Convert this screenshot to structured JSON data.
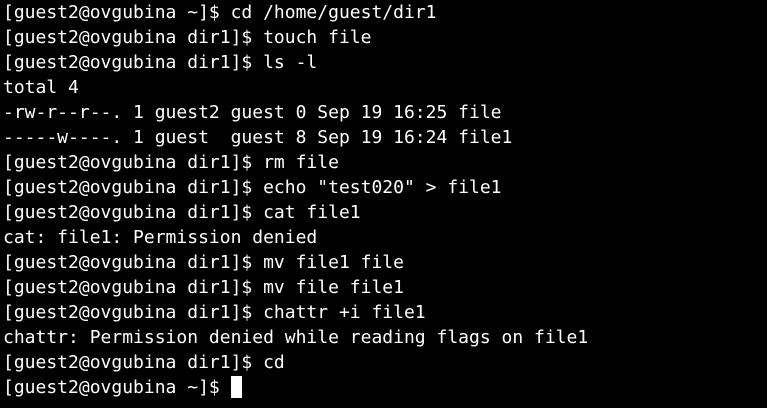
{
  "terminal": {
    "lines": [
      "[guest2@ovgubina ~]$ cd /home/guest/dir1",
      "[guest2@ovgubina dir1]$ touch file",
      "[guest2@ovgubina dir1]$ ls -l",
      "total 4",
      "-rw-r--r--. 1 guest2 guest 0 Sep 19 16:25 file",
      "-----w----. 1 guest  guest 8 Sep 19 16:24 file1",
      "[guest2@ovgubina dir1]$ rm file",
      "[guest2@ovgubina dir1]$ echo \"test020\" > file1",
      "[guest2@ovgubina dir1]$ cat file1",
      "cat: file1: Permission denied",
      "[guest2@ovgubina dir1]$ mv file1 file",
      "[guest2@ovgubina dir1]$ mv file file1",
      "[guest2@ovgubina dir1]$ chattr +i file1",
      "chattr: Permission denied while reading flags on file1",
      "[guest2@ovgubina dir1]$ cd"
    ],
    "prompt": "[guest2@ovgubina ~]$ "
  },
  "colors": {
    "background": "#000000",
    "foreground": "#ffffff"
  }
}
